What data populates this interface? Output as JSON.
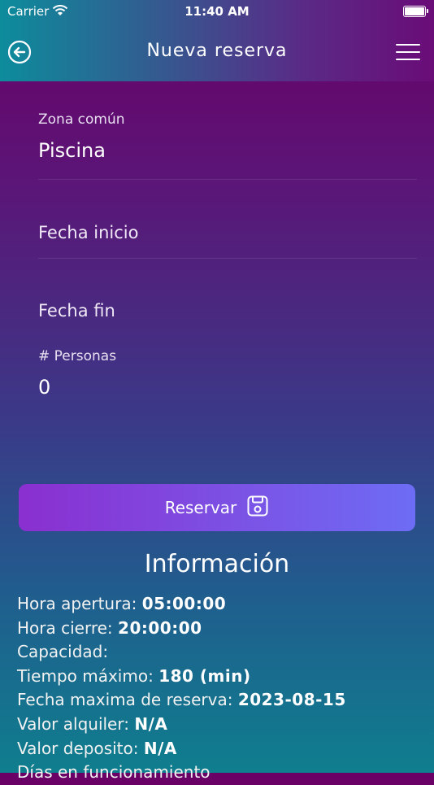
{
  "status_bar": {
    "carrier": "Carrier",
    "time": "11:40 AM"
  },
  "header": {
    "title": "Nueva reserva"
  },
  "form": {
    "zona": {
      "label": "Zona común",
      "value": "Piscina"
    },
    "fecha_inicio": {
      "placeholder": "Fecha inicio"
    },
    "fecha_fin": {
      "placeholder": "Fecha fin"
    },
    "personas": {
      "label": "# Personas",
      "value": "0"
    }
  },
  "actions": {
    "reservar_label": "Reservar"
  },
  "info": {
    "title": "Información",
    "rows": [
      {
        "label": "Hora apertura:",
        "value": "05:00:00"
      },
      {
        "label": "Hora cierre:",
        "value": "20:00:00"
      },
      {
        "label": "Capacidad:",
        "value": ""
      },
      {
        "label": "Tiempo máximo:",
        "value": "180 (min)"
      },
      {
        "label": "Fecha maxima de reserva:",
        "value": "2023-08-15"
      },
      {
        "label": "Valor alquiler:",
        "value": "N/A"
      },
      {
        "label": "Valor deposito:",
        "value": "N/A"
      },
      {
        "label": "Días en funcionamiento",
        "value": ""
      }
    ]
  },
  "colors": {
    "header_start": "#0d8c9c",
    "header_end": "#6a0c78",
    "button_start": "#8a2fd0",
    "button_end": "#6d6cf5"
  },
  "icons": {
    "back": "circle-arrow-left-icon",
    "menu": "hamburger-menu-icon",
    "save": "floppy-disk-icon",
    "wifi": "wifi-icon",
    "battery": "battery-icon"
  }
}
